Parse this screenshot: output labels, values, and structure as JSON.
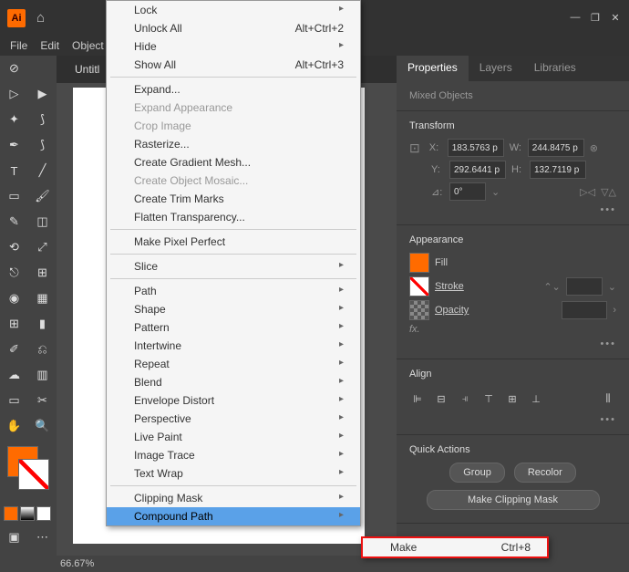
{
  "app": {
    "logo": "Ai"
  },
  "menubar": [
    "File",
    "Edit",
    "Object"
  ],
  "tab": {
    "title": "Untitl"
  },
  "status": {
    "zoom": "66.67%"
  },
  "window_controls": {
    "min": "—",
    "restore": "❐",
    "close": "✕"
  },
  "header_icons": {
    "search": "🔍"
  },
  "dropdown": {
    "items": [
      {
        "label": "Lock",
        "arrow": true
      },
      {
        "label": "Unlock All",
        "shortcut": "Alt+Ctrl+2"
      },
      {
        "label": "Hide",
        "arrow": true
      },
      {
        "label": "Show All",
        "shortcut": "Alt+Ctrl+3"
      },
      {
        "sep": true
      },
      {
        "label": "Expand..."
      },
      {
        "label": "Expand Appearance",
        "disabled": true
      },
      {
        "label": "Crop Image",
        "disabled": true
      },
      {
        "label": "Rasterize..."
      },
      {
        "label": "Create Gradient Mesh..."
      },
      {
        "label": "Create Object Mosaic...",
        "disabled": true
      },
      {
        "label": "Create Trim Marks"
      },
      {
        "label": "Flatten Transparency..."
      },
      {
        "sep": true
      },
      {
        "label": "Make Pixel Perfect"
      },
      {
        "sep": true
      },
      {
        "label": "Slice",
        "arrow": true
      },
      {
        "sep": true
      },
      {
        "label": "Path",
        "arrow": true
      },
      {
        "label": "Shape",
        "arrow": true
      },
      {
        "label": "Pattern",
        "arrow": true
      },
      {
        "label": "Intertwine",
        "arrow": true
      },
      {
        "label": "Repeat",
        "arrow": true
      },
      {
        "label": "Blend",
        "arrow": true
      },
      {
        "label": "Envelope Distort",
        "arrow": true
      },
      {
        "label": "Perspective",
        "arrow": true
      },
      {
        "label": "Live Paint",
        "arrow": true
      },
      {
        "label": "Image Trace",
        "arrow": true
      },
      {
        "label": "Text Wrap",
        "arrow": true
      },
      {
        "sep": true
      },
      {
        "label": "Clipping Mask",
        "arrow": true
      },
      {
        "label": "Compound Path",
        "arrow": true,
        "selected": true
      }
    ],
    "submenu": {
      "label": "Make",
      "shortcut": "Ctrl+8"
    }
  },
  "properties": {
    "tabs": [
      "Properties",
      "Layers",
      "Libraries"
    ],
    "selection": "Mixed Objects",
    "transform": {
      "title": "Transform",
      "x_label": "X:",
      "x": "183.5763 p",
      "y_label": "Y:",
      "y": "292.6441 p",
      "w_label": "W:",
      "w": "244.8475 p",
      "h_label": "H:",
      "h": "132.7119 p",
      "angle_label": "⊿:",
      "angle": "0°"
    },
    "appearance": {
      "title": "Appearance",
      "fill": "Fill",
      "stroke": "Stroke",
      "opacity": "Opacity",
      "fx": "fx."
    },
    "align": {
      "title": "Align"
    },
    "quick_actions": {
      "title": "Quick Actions",
      "group": "Group",
      "recolor": "Recolor",
      "clipping_mask": "Make Clipping Mask"
    }
  }
}
